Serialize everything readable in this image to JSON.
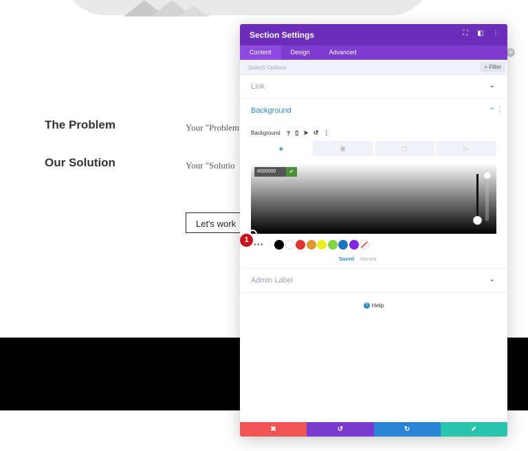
{
  "page": {
    "rows": [
      {
        "heading": "The Problem",
        "text": "Your \"Problem"
      },
      {
        "heading": "Our Solution",
        "text": "Your \"Solutio"
      }
    ],
    "cta_label": "Let's work",
    "edge_close_glyph": "✕"
  },
  "modal": {
    "title": "Section Settings",
    "header_icons": [
      "expand-icon",
      "sidebar-toggle-icon",
      "kebab-menu-icon"
    ],
    "tabs": [
      "Content",
      "Design",
      "Advanced"
    ],
    "active_tab": "Content",
    "search": {
      "placeholder": "Search Options"
    },
    "filter_label": "+ Filter",
    "link_section": "Link",
    "background_section": "Background",
    "background_row": {
      "label": "Background",
      "icons": [
        "help-icon",
        "mobile-icon",
        "pointer-icon",
        "reset-icon",
        "kebab-icon"
      ]
    },
    "bg_tabs": [
      "color-fill-icon",
      "gradient-icon",
      "image-icon",
      "video-icon"
    ],
    "color_picker": {
      "hex_value": "#000000",
      "marker_number": "1",
      "swatches": [
        "#000000",
        "#ffffff",
        "#dd3333",
        "#dd9933",
        "#eeee22",
        "#81d742",
        "#1e73be",
        "#8224e3"
      ],
      "saved_label": "Saved",
      "recent_label": "Recent"
    },
    "admin_label_section": "Admin Label",
    "help_label": "Help",
    "footer": {
      "cancel": "✖",
      "undo": "↺",
      "redo": "↻",
      "save": "✔"
    },
    "accent_colors": {
      "header": "#6c2eb9",
      "tabs": "#7d3bd0",
      "link_blue": "#2e8ab8"
    }
  }
}
